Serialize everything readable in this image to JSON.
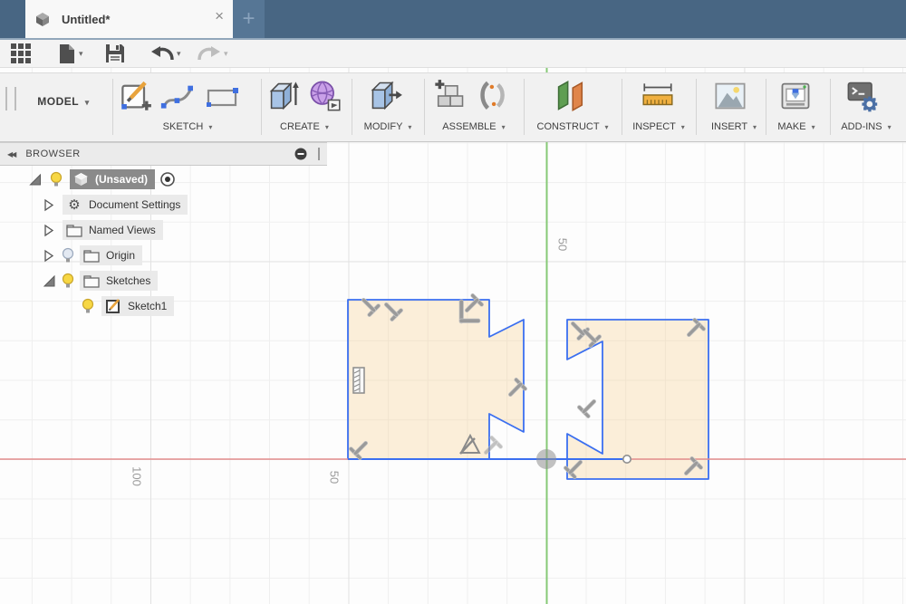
{
  "ui": {
    "caret": "▾",
    "collapse_glyph": "◀◀",
    "close_glyph": "×",
    "new_tab_glyph": "+",
    "gear_glyph": "⚙"
  },
  "tab_bar": {
    "document_title": "Untitled*"
  },
  "ribbon": {
    "model_label": "MODEL",
    "groups": [
      {
        "label": "SKETCH"
      },
      {
        "label": "CREATE"
      },
      {
        "label": "MODIFY"
      },
      {
        "label": "ASSEMBLE"
      },
      {
        "label": "CONSTRUCT"
      },
      {
        "label": "INSPECT"
      },
      {
        "label": "INSERT"
      },
      {
        "label": "MAKE"
      },
      {
        "label": "ADD-INS"
      }
    ]
  },
  "browser": {
    "header_label": "BROWSER",
    "root": {
      "label": "(Unsaved)"
    },
    "items": [
      {
        "label": "Document Settings"
      },
      {
        "label": "Named Views"
      },
      {
        "label": "Origin"
      },
      {
        "label": "Sketches"
      },
      {
        "label": "Sketch1"
      }
    ]
  },
  "canvas": {
    "y_axis_label": "50",
    "x_axis_labels": [
      "100",
      "50"
    ],
    "colors": {
      "x_axis": "#e58e8e",
      "y_axis": "#86c976",
      "sketch_stroke": "#3b6ff0",
      "sketch_fill": "rgba(245,210,150,0.35)",
      "selection_gray": "#8a8a8a",
      "tab_bar": "#486683"
    }
  }
}
